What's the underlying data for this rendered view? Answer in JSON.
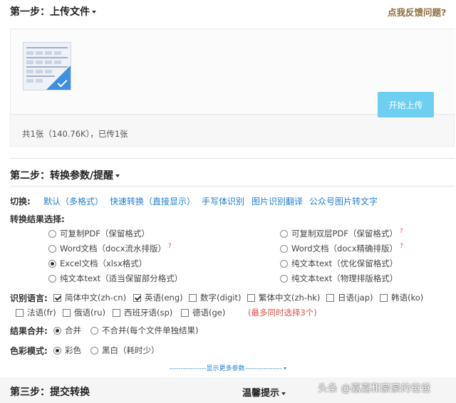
{
  "step1": {
    "title": "第一步：上传文件",
    "feedback": "点我反馈问题?"
  },
  "upload": {
    "status": "共1张（140.76K），已传1张",
    "start_button": "开始上传"
  },
  "step2": {
    "title": "第二步：转换参数/提醒"
  },
  "switch": {
    "label": "切换:",
    "links": [
      "默认（多格式）",
      "快速转换（直接显示）",
      "手写体识别",
      "图片识别翻译",
      "公众号图片转文字"
    ]
  },
  "result": {
    "label": "转换结果选择:",
    "options_left": [
      "可复制PDF（保留格式）",
      "Word文档（docx流水排版）",
      "Excel文档（xlsx格式）",
      "纯文本text（适当保留部分格式）"
    ],
    "options_right": [
      "可复制双层PDF（保留格式）",
      "Word文档（docx精确排版）",
      "纯文本text（优化保留格式）",
      "纯文本text（物理排版格式）"
    ],
    "help_mark": "?"
  },
  "language": {
    "label": "识别语言:",
    "options": [
      "简体中文(zh-cn)",
      "英语(eng)",
      "数字(digit)",
      "繁体中文(zh-hk)",
      "日语(jap)",
      "韩语(ko)",
      "法语(fr)",
      "俄语(ru)",
      "西班牙语(sp)",
      "德语(ge)"
    ],
    "warning": "(最多同时选择3个)"
  },
  "merge": {
    "label": "结果合并:",
    "options": [
      "合并",
      "不合并(每个文件单独结果)"
    ]
  },
  "color": {
    "label": "色彩模式:",
    "options": [
      "彩色",
      "黑白（耗时少）"
    ]
  },
  "more": {
    "label": "----------------显示更多参数----------------"
  },
  "step3": {
    "title": "第三步：提交转换",
    "tips": "温馨提示"
  },
  "watermark": "头条 @嘉嘉和豪豪的爸爸"
}
